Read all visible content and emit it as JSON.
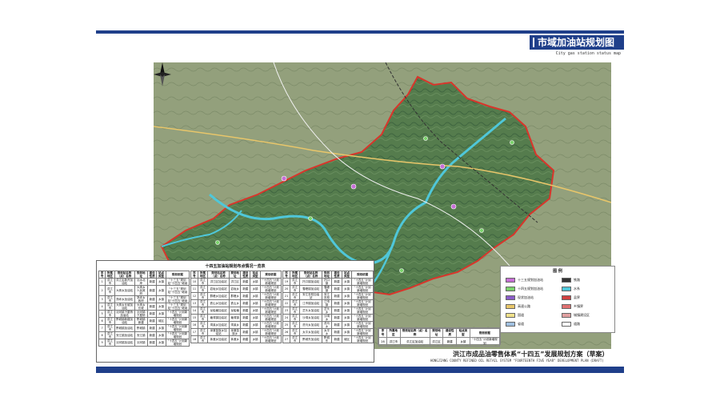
{
  "header": {
    "title": "市域加油站规划图",
    "subtitle": "City gas station status map"
  },
  "footer": {
    "title_cn": "洪江市成品油零售体系“十四五”发展规划方案（草案）",
    "title_en": "HONGJIANG COUNTY REFINED OIL RETAIL SYSTEM \"FOURTEENTH FIVE YEAR\" DEVELOPMENT PLAN (DRAFT)"
  },
  "table": {
    "title": "十四五加油站规划布点情况一览表",
    "headers": [
      "序号",
      "所属地区",
      "规划站名称（点）名称",
      "规划地址",
      "建设性质",
      "站点类型",
      "规划依据"
    ],
    "col1": [
      [
        "1",
        "洪江市",
        "洪江区新开加油站",
        "沅水北岸",
        "新建",
        "乡镇",
        "“十三五”规划站“十四五”继续"
      ],
      [
        "2",
        "洪江市",
        "大崇乡加油站",
        "大崇乡人民政府",
        "新建",
        "乡镇",
        "“十三五”规划站“十四五”继续"
      ],
      [
        "3",
        "洪江市",
        "熟坪乡加油站",
        "熟坪乡政府",
        "新建",
        "乡镇",
        "“十三五”规划站“十四五”继续"
      ],
      [
        "4",
        "洪江市",
        "大崇乡长坡加油站",
        "大崇乡长坡",
        "新建",
        "乡镇",
        "“十三五”规划站“十四五”继续"
      ],
      [
        "5",
        "洪江市",
        "沅河镇下屋桥加油站",
        "沅河镇下屋桥",
        "新建",
        "乡镇",
        "“十四五”计划新增规划"
      ],
      [
        "6",
        "洪江市",
        "黔城镇新建加油站",
        "黔城镇新建",
        "新建",
        "城区",
        "“十四五”计划新增规划"
      ],
      [
        "7",
        "洪江市",
        "黔城镇加油站",
        "黔城镇",
        "新建",
        "乡镇",
        "“十四五”计划新增规划"
      ],
      [
        "8",
        "洪江市",
        "安江镇加油站",
        "安江镇",
        "新建",
        "乡镇",
        "“十四五”计划新增规划"
      ],
      [
        "9",
        "洪江市",
        "沅河镇加油站",
        "沅河镇",
        "新建",
        "乡镇",
        "“十四五”计划新增规划"
      ]
    ],
    "col2": [
      [
        "10",
        "洪江市",
        "洪江区加油站",
        "洪江区",
        "新建",
        "乡镇",
        "“十四五”计划新增规划"
      ],
      [
        "11",
        "洪江市",
        "岩垅乡加油站",
        "岩垅乡",
        "新建",
        "乡镇",
        "“十四五”计划新增规划"
      ],
      [
        "12",
        "洪江市",
        "群峰乡加油站",
        "群峰乡",
        "新建",
        "乡镇",
        "“十四五”计划新增规划"
      ],
      [
        "13",
        "洪江市",
        "铁山乡加油站",
        "铁山乡",
        "新建",
        "乡镇",
        "“十四五”计划新增规划"
      ],
      [
        "14",
        "洪江市",
        "龙船塘加油站",
        "龙船塘",
        "新建",
        "乡镇",
        "“十四五”计划新增规划"
      ],
      [
        "15",
        "洪江市",
        "塘湾镇加油站",
        "塘湾镇",
        "新建",
        "乡镇",
        "“十四五”计划新增规划"
      ],
      [
        "16",
        "洪江市",
        "湾溪乡加油站",
        "湾溪乡",
        "新建",
        "乡镇",
        "“十四五”计划新增规划"
      ],
      [
        "17",
        "洪江市",
        "深渡苗族乡加油站",
        "深渡苗族乡",
        "新建",
        "乡镇",
        "“十四五”计划新增规划"
      ],
      [
        "18",
        "洪江市",
        "茅渡乡加油站",
        "茅渡乡",
        "新建",
        "乡镇",
        "“十四五”计划新增规划"
      ]
    ],
    "col3": [
      [
        "19",
        "洪江市",
        "托口镇加油站",
        "托口镇",
        "新建",
        "乡镇",
        "“十四五”计划新增规划"
      ],
      [
        "20",
        "洪江市",
        "雪峰镇加油站",
        "雪峰镇",
        "新建",
        "乡镇",
        "“十四五”计划新增规划"
      ],
      [
        "21",
        "洪江市",
        "安江农校加油站",
        "安江农校",
        "新建",
        "乡镇",
        "“十四五”计划新增规划"
      ],
      [
        "22",
        "洪江市",
        "江市镇加油站",
        "江市镇",
        "新建",
        "乡镇",
        "“十四五”计划新增规划"
      ],
      [
        "23",
        "洪江市",
        "岔头乡加油站",
        "岔头乡",
        "新建",
        "乡镇",
        "“十四五”计划新增规划"
      ],
      [
        "24",
        "洪江市",
        "沙湾乡加油站",
        "沙湾乡",
        "新建",
        "乡镇",
        "“十四五”计划新增规划"
      ],
      [
        "25",
        "洪江市",
        "洗马乡加油站",
        "洗马乡",
        "新建",
        "乡镇",
        "“十四五”计划新增规划"
      ],
      [
        "26",
        "洪江市",
        "太平乡加油站",
        "太平乡",
        "新建",
        "乡镇",
        "“十四五”计划新增规划"
      ],
      [
        "27",
        "洪江市",
        "黔城东加油站",
        "黔城东",
        "新建",
        "城区",
        "“十四五”计划新增规划"
      ]
    ]
  },
  "legend": {
    "title": "图 例",
    "items": [
      {
        "label": "十三五规划加油站",
        "color": "#c76fd6"
      },
      {
        "label": "十四五规划加油站",
        "color": "#7ad36b"
      },
      {
        "label": "现状加油站",
        "color": "#8a5cc9"
      },
      {
        "label": "高速公路",
        "color": "#e8c66a"
      },
      {
        "label": "国道",
        "color": "#f0e08a"
      },
      {
        "label": "省道",
        "color": "#a0c0e0"
      },
      {
        "label": "铁路",
        "color": "#333333"
      },
      {
        "label": "水系",
        "color": "#4fc7d9"
      },
      {
        "label": "县界",
        "color": "#d04040"
      },
      {
        "label": "乡镇界",
        "color": "#e07070"
      },
      {
        "label": "城镇建设区",
        "color": "#e0a0a0"
      },
      {
        "label": "道路",
        "color": "#ffffff"
      }
    ]
  },
  "small_table": {
    "headers": [
      "序号",
      "所属地区",
      "规划站名称（点）名称",
      "规划地址",
      "建设性质",
      "站点类型",
      "规划依据"
    ],
    "row": [
      "28",
      "洪江市",
      "洪江区加油站",
      "洪江区",
      "新建",
      "乡镇",
      "“十四五”计划新增规划"
    ]
  },
  "map": {
    "boundary_color": "#d9352b",
    "river_color": "#4fc7d9",
    "terrain_color": "#4f7a4a"
  }
}
